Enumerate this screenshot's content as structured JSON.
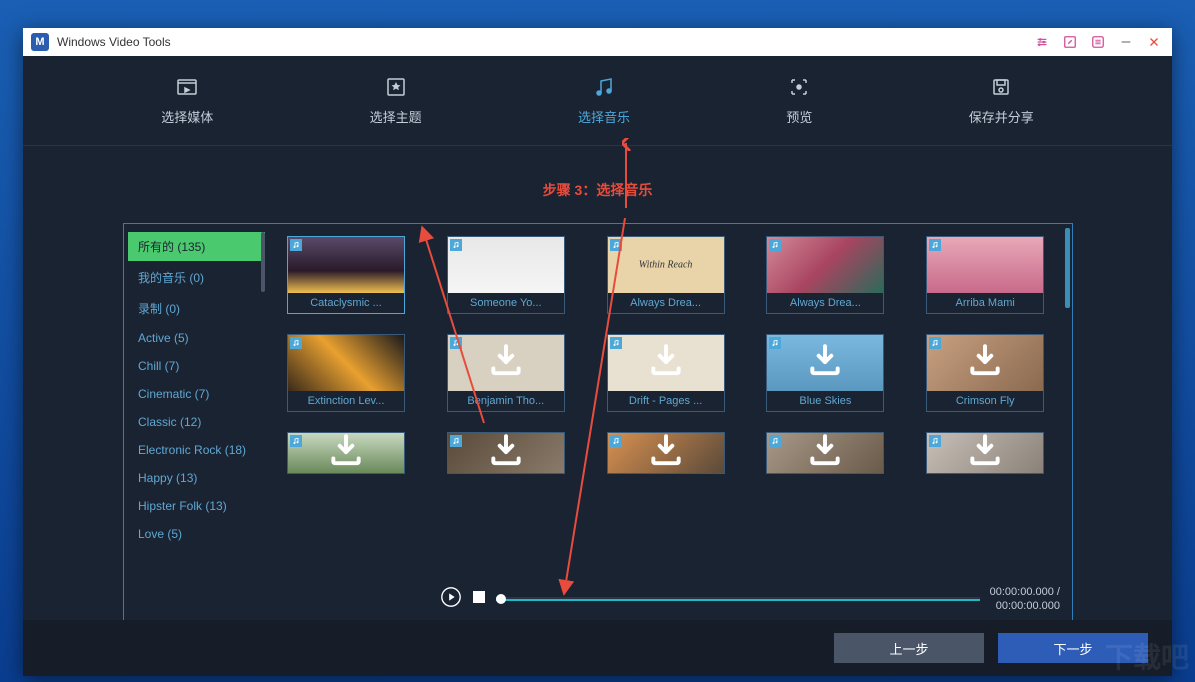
{
  "app": {
    "title": "Windows Video Tools"
  },
  "nav": {
    "items": [
      {
        "label": "选择媒体",
        "active": false
      },
      {
        "label": "选择主题",
        "active": false
      },
      {
        "label": "选择音乐",
        "active": true
      },
      {
        "label": "预览",
        "active": false
      },
      {
        "label": "保存并分享",
        "active": false
      }
    ]
  },
  "annotation": {
    "text": "步骤 3：选择音乐"
  },
  "sidebar": {
    "items": [
      {
        "label": "所有的 (135)",
        "active": true
      },
      {
        "label": "我的音乐 (0)"
      },
      {
        "label": "录制 (0)"
      },
      {
        "label": "Active (5)"
      },
      {
        "label": "Chill (7)"
      },
      {
        "label": "Cinematic (7)"
      },
      {
        "label": "Classic (12)"
      },
      {
        "label": "Electronic Rock (18)"
      },
      {
        "label": "Happy (13)"
      },
      {
        "label": "Hipster Folk (13)"
      },
      {
        "label": "Love (5)"
      }
    ]
  },
  "tracks": [
    {
      "label": "Cataclysmic ...",
      "dl": false,
      "th": "th1",
      "sel": true
    },
    {
      "label": "Someone Yo...",
      "dl": false,
      "th": "th2"
    },
    {
      "label": "Always Drea...",
      "dl": false,
      "th": "th3",
      "text": "Within Reach"
    },
    {
      "label": "Always Drea...",
      "dl": false,
      "th": "th4"
    },
    {
      "label": "Arriba Mami",
      "dl": false,
      "th": "th5"
    },
    {
      "label": "Extinction Lev...",
      "dl": false,
      "th": "th6"
    },
    {
      "label": "Benjamin Tho...",
      "dl": true,
      "th": "th7"
    },
    {
      "label": "Drift - Pages ...",
      "dl": true,
      "th": "th8"
    },
    {
      "label": "Blue Skies",
      "dl": true,
      "th": "th9"
    },
    {
      "label": "Crimson Fly",
      "dl": true,
      "th": "th10"
    },
    {
      "label": "",
      "dl": true,
      "th": "th11",
      "partial": true
    },
    {
      "label": "",
      "dl": true,
      "th": "th12",
      "partial": true
    },
    {
      "label": "",
      "dl": true,
      "th": "th13",
      "partial": true
    },
    {
      "label": "",
      "dl": true,
      "th": "th14",
      "partial": true
    },
    {
      "label": "",
      "dl": true,
      "th": "th15",
      "partial": true
    }
  ],
  "player": {
    "current": "00:00:00.000",
    "total": "00:00:00.000",
    "sep": " / "
  },
  "footer": {
    "prev": "上一步",
    "next": "下一步"
  },
  "watermark": "下载吧"
}
